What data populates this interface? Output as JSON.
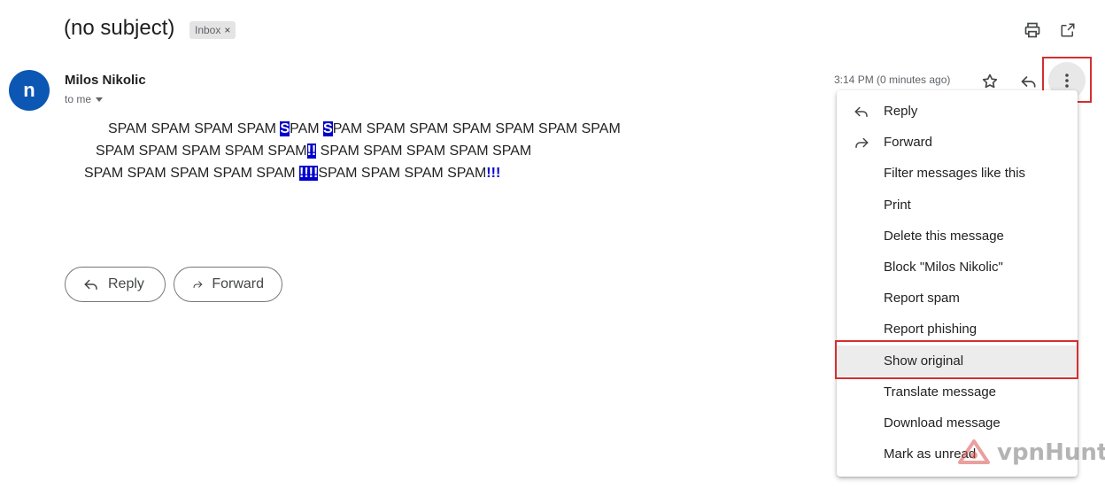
{
  "header": {
    "subject": "(no subject)",
    "label": "Inbox",
    "label_close": "×"
  },
  "sender": {
    "avatar_letter": "n",
    "name": "Milos Nikolic",
    "recipient": "to me",
    "timestamp": "3:14 PM (0 minutes ago)"
  },
  "body": {
    "line1": {
      "a": "SPAM SPAM SPAM SPAM ",
      "h1": "S",
      "b": "PAM ",
      "h2": "S",
      "c": "PAM SPAM SPAM SPAM SPAM SPAM SPAM"
    },
    "line2": {
      "a": "SPAM SPAM SPAM SPAM SPAM",
      "h1": "!!",
      "b": " SPAM SPAM SPAM SPAM SPAM"
    },
    "line3": {
      "a": "SPAM SPAM SPAM SPAM SPAM ",
      "h1": "!!!!",
      "b": "SPAM SPAM SPAM SPAM",
      "bang": "!!!"
    }
  },
  "actions": {
    "reply_label": "Reply",
    "forward_label": "Forward"
  },
  "menu": {
    "items": [
      {
        "label": "Reply",
        "icon": "reply-icon"
      },
      {
        "label": "Forward",
        "icon": "forward-icon"
      },
      {
        "label": "Filter messages like this"
      },
      {
        "label": "Print"
      },
      {
        "label": "Delete this message"
      },
      {
        "label": "Block \"Milos Nikolic\""
      },
      {
        "label": "Report spam"
      },
      {
        "label": "Report phishing"
      },
      {
        "label": "Show original",
        "selected": true
      },
      {
        "label": "Translate message"
      },
      {
        "label": "Download message"
      },
      {
        "label": "Mark as unread"
      }
    ]
  },
  "watermark": {
    "text": "vpnHunt"
  },
  "colors": {
    "avatar": "#0b57b3",
    "highlight": "#0000cc",
    "annotation": "#d32f2f"
  }
}
